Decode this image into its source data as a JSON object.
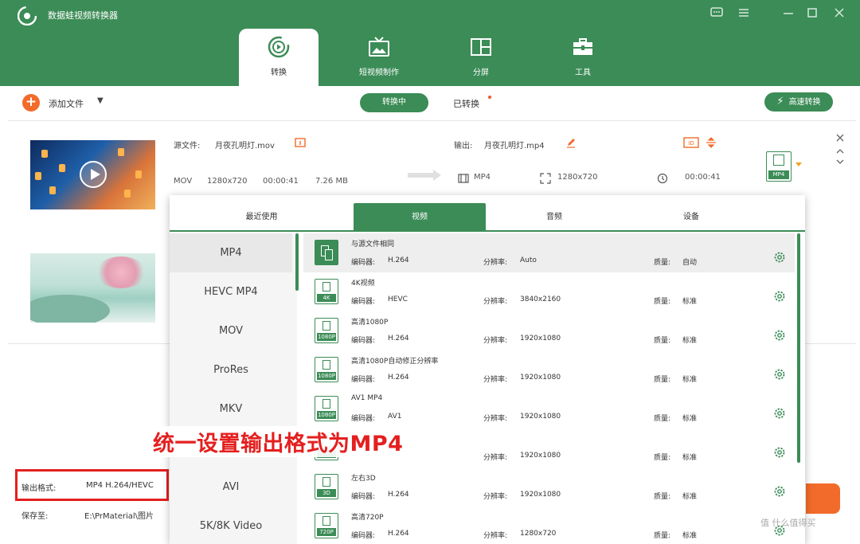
{
  "app": {
    "title": "数据蛙视频转换器"
  },
  "nav_tabs": [
    {
      "label": "转换",
      "icon": "convert-icon",
      "active": true
    },
    {
      "label": "短视频制作",
      "icon": "tv-icon",
      "active": false
    },
    {
      "label": "分屏",
      "icon": "split-screen-icon",
      "active": false
    },
    {
      "label": "工具",
      "icon": "toolbox-icon",
      "active": false
    }
  ],
  "toolbar": {
    "add_label": "添加文件",
    "converting_label": "转换中",
    "converted_label": "已转换",
    "fast_label": "高速转换"
  },
  "file1": {
    "source_label": "源文件:",
    "source_name": "月夜孔明灯.mov",
    "output_label": "输出:",
    "output_name": "月夜孔明灯.mp4",
    "src_format": "MOV",
    "src_resolution": "1280x720",
    "src_duration": "00:00:41",
    "src_size": "7.26 MB",
    "out_format": "MP4",
    "out_resolution": "1280x720",
    "out_duration": "00:00:41",
    "out_icon_tag": "MP4"
  },
  "popup": {
    "tabs": [
      {
        "label": "最近使用",
        "active": false
      },
      {
        "label": "视频",
        "active": true
      },
      {
        "label": "音频",
        "active": false
      },
      {
        "label": "设备",
        "active": false
      }
    ],
    "formats": [
      "MP4",
      "HEVC MP4",
      "MOV",
      "ProRes",
      "MKV",
      "",
      "AVI",
      "5K/8K Video"
    ],
    "codec_label": "编码器:",
    "resolution_label": "分辨率:",
    "quality_label": "质量:",
    "presets": [
      {
        "name": "与源文件相同",
        "codec": "H.264",
        "resolution": "Auto",
        "quality": "自动",
        "tag": ""
      },
      {
        "name": "4K视频",
        "codec": "HEVC",
        "resolution": "3840x2160",
        "quality": "标准",
        "tag": "4K"
      },
      {
        "name": "高清1080P",
        "codec": "H.264",
        "resolution": "1920x1080",
        "quality": "标准",
        "tag": "1080P"
      },
      {
        "name": "高清1080P自动修正分辨率",
        "codec": "H.264",
        "resolution": "1920x1080",
        "quality": "标准",
        "tag": "1080P"
      },
      {
        "name": "AV1 MP4",
        "codec": "AV1",
        "resolution": "1920x1080",
        "quality": "标准",
        "tag": "1080P"
      },
      {
        "name": "",
        "codec": "",
        "resolution": "1920x1080",
        "quality": "标准",
        "tag": ""
      },
      {
        "name": "左右3D",
        "codec": "H.264",
        "resolution": "1920x1080",
        "quality": "标准",
        "tag": "3D"
      },
      {
        "name": "高清720P",
        "codec": "H.264",
        "resolution": "1280x720",
        "quality": "标准",
        "tag": "720P"
      }
    ]
  },
  "bottom": {
    "output_format_label": "输出格式:",
    "output_format_value": "MP4 H.264/HEVC",
    "save_label": "保存至:",
    "save_path": "E:\\PrMaterial\\图片"
  },
  "annotation": "统一设置输出格式为MP4",
  "watermark": "值 什么值得买"
}
